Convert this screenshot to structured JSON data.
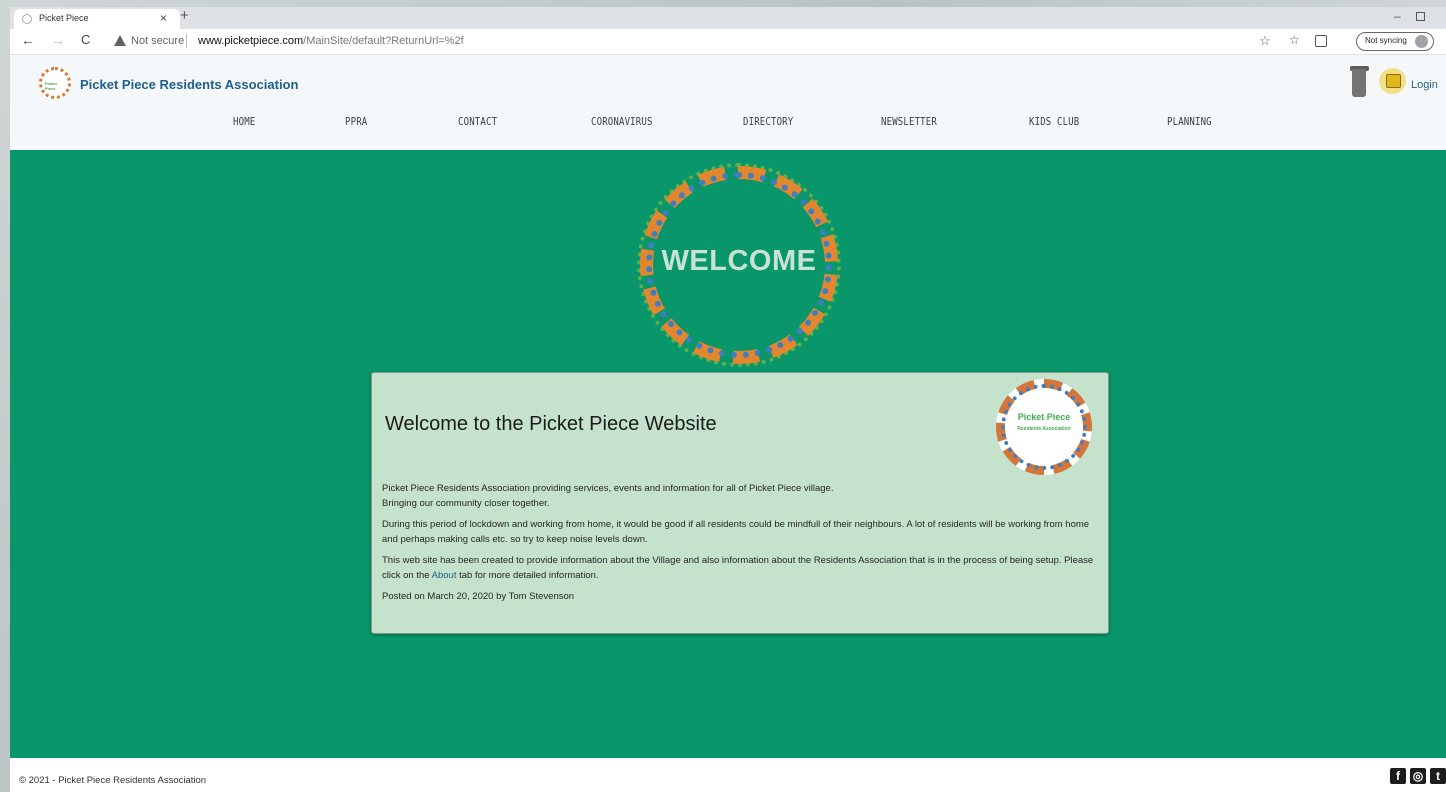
{
  "browser": {
    "tab_title": "Picket Piece",
    "tab_close": "×",
    "new_tab": "+",
    "min_glyph": "–",
    "back": "←",
    "forward": "→",
    "reload": "C",
    "security_text": "Not secure",
    "url_domain": "www.picketpiece.com",
    "url_path": "/MainSite/default?ReturnUrl=%2f",
    "sync_text": "Not syncing"
  },
  "header": {
    "logo_text": "Picket Piece",
    "site_title": "Picket Piece Residents Association",
    "login_label": "Login"
  },
  "nav": {
    "items": [
      "HOME",
      "PPRA",
      "CONTACT",
      "CORONAVIRUS",
      "DIRECTORY",
      "NEWSLETTER",
      "KIDS CLUB",
      "PLANNING"
    ]
  },
  "hero": {
    "welcome_text": "WELCOME"
  },
  "card": {
    "title": "Welcome to the Picket Piece Website",
    "logo_line1": "Picket Piece",
    "logo_line2": "Residents Association",
    "p1_line1": "Picket Piece Residents Association providing services, events and information for all of Picket Piece village.",
    "p1_line2": "Bringing our community closer together.",
    "p2": "During this period of lockdown and working from home, it would be good if all residents could be mindfull of their neighbours. A lot of residents will be working from home and perhaps making calls etc. so try to keep noise levels down.",
    "p3_before": "This web site has been created to provide information about the Village and also information about the Residents Association that is in the process of being setup. Please click on the ",
    "p3_link": "About",
    "p3_after": " tab for more detailed information.",
    "posted": "Posted on March 20, 2020 by Tom Stevenson"
  },
  "footer": {
    "copyright": "© 2021 - Picket Piece Residents Association",
    "facebook_glyph": "f",
    "instagram_glyph": "◎",
    "twitter_glyph": "t"
  },
  "colors": {
    "main_bg": "#09966a",
    "card_bg": "#c5e2cd",
    "title_blue": "#1f5f8c"
  }
}
